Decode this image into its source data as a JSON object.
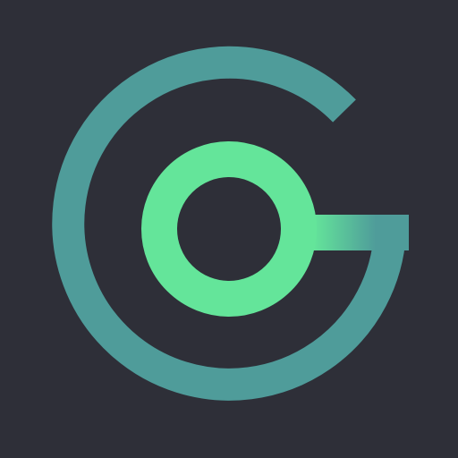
{
  "icon": {
    "name": "go-logo-icon",
    "background_color": "#2e2f38",
    "outer_ring_color": "#4f9c9a",
    "inner_ring_color": "#64e59a"
  }
}
